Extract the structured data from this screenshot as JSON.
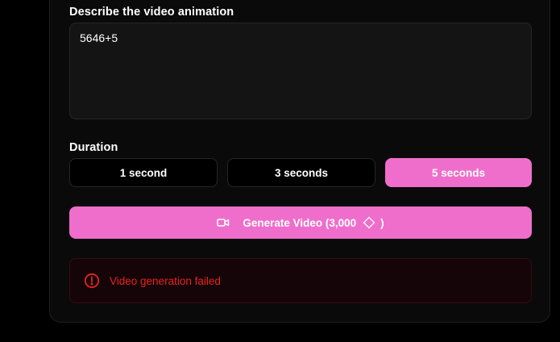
{
  "prompt": {
    "label": "Describe the video animation",
    "value": "5646+5"
  },
  "duration": {
    "label": "Duration",
    "options": [
      "1 second",
      "3 seconds",
      "5 seconds"
    ],
    "selected": "5 seconds"
  },
  "generate": {
    "label_prefix": "Generate Video (3,000",
    "label_suffix": ")",
    "icon": "video-camera-icon",
    "credit_icon": "diamond-icon"
  },
  "error": {
    "message": "Video generation failed",
    "icon": "alert-circle-icon"
  },
  "colors": {
    "accent": "#ef6ecb",
    "error": "#e8231f",
    "background": "#000000"
  }
}
